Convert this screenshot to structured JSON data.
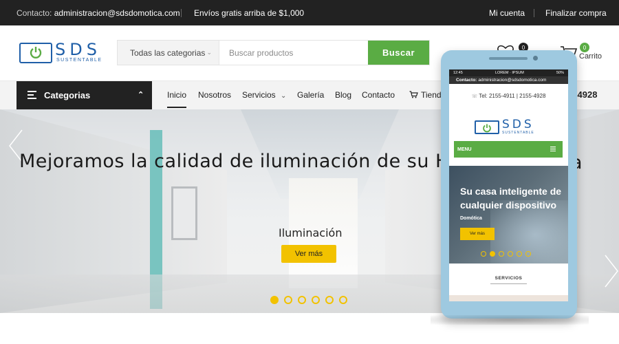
{
  "topbar": {
    "contact_label": "Contacto:",
    "contact_email": "administracion@sdsdomotica.com",
    "shipping": "Envíos gratis arriba de $1,000",
    "account": "Mi cuenta",
    "checkout": "Finalizar compra"
  },
  "logo": {
    "main": "SDS",
    "sub": "SUSTENTABLE"
  },
  "search": {
    "category": "Todas las categorias",
    "placeholder": "Buscar productos",
    "button": "Buscar"
  },
  "header": {
    "wishlist_count": "0",
    "cart_count": "0",
    "cart_label": "Carrito"
  },
  "nav": {
    "categories_button": "Categorias",
    "items": [
      "Inicio",
      "Nosotros",
      "Servicios",
      "Galería",
      "Blog",
      "Contacto",
      "Tienda"
    ],
    "phone_partial": "5-4928"
  },
  "hero": {
    "headline": "Mejoramos la calidad de iluminación de su H",
    "headline_tail": "a",
    "subtitle": "Iluminación",
    "button": "Ver más",
    "slide_count": 6,
    "active_slide": 1
  },
  "mobile": {
    "status_time": "12:45",
    "status_carriers": "LOREM  ·  IPSUM",
    "status_battery": "50%",
    "contact_label": "Contacto:",
    "contact_email": "administracion@sdsdomotica.com",
    "tel": "Tel: 2155-4911 | 2155-4928",
    "logo_main": "SDS",
    "logo_sub": "SUSTENTABLE",
    "menu": "MENU",
    "hero_line1": "Su casa inteligente de",
    "hero_line2": "cualquier dispositivo",
    "hero_tag": "Domótica",
    "hero_button": "Ver más",
    "section": "SERVICIOS"
  },
  "colors": {
    "green": "#5aac44",
    "dark": "#222222",
    "yellow": "#f2c200",
    "logo_blue": "#1f5fa8"
  }
}
